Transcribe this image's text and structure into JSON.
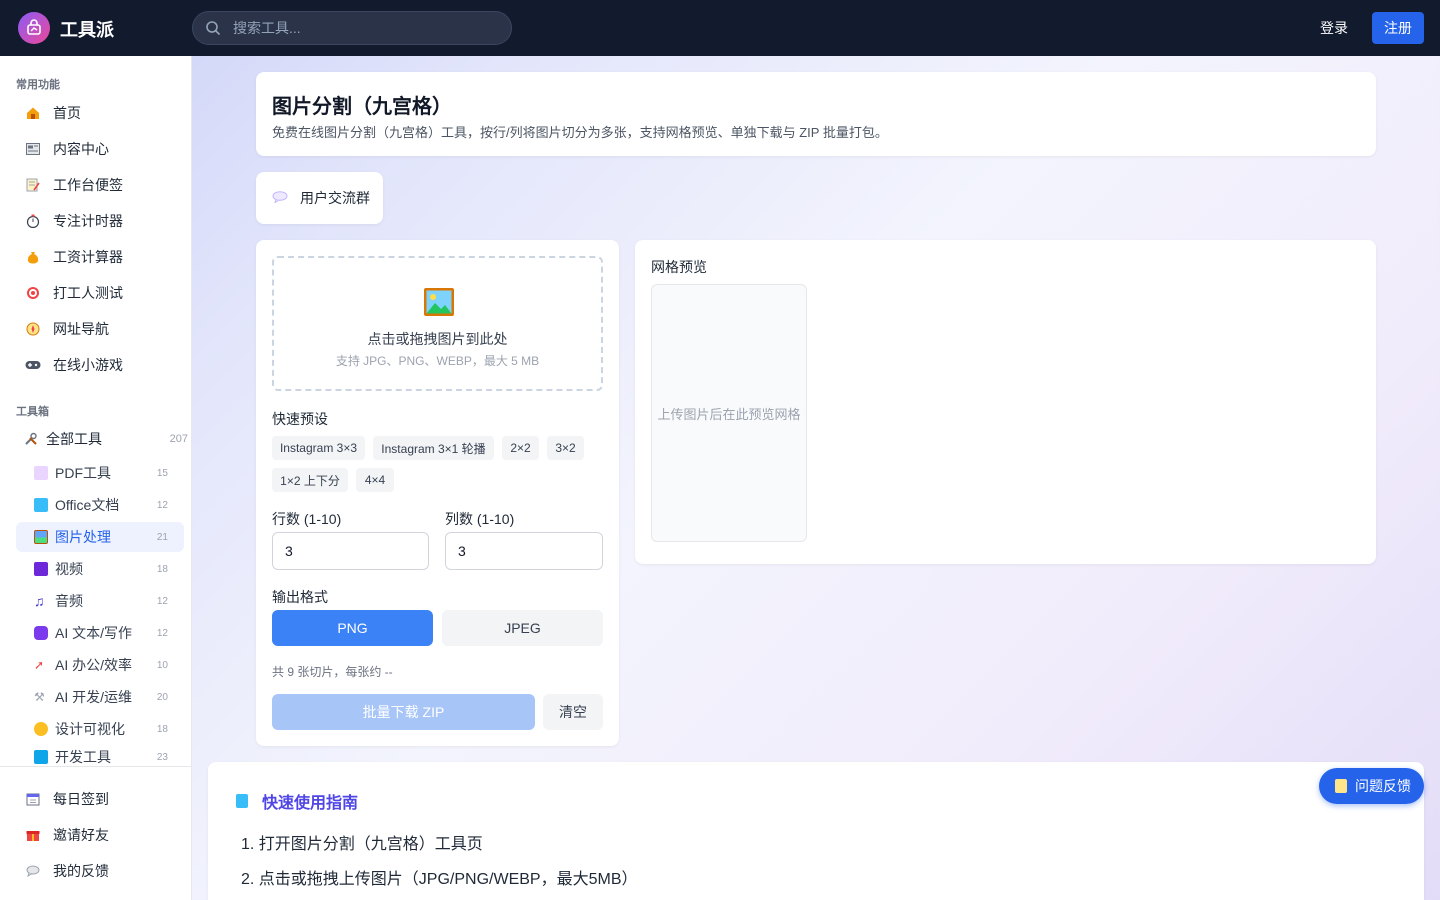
{
  "header": {
    "brand": "工具派",
    "search_placeholder": "搜索工具...",
    "login": "登录",
    "register": "注册"
  },
  "sidebar": {
    "common_title": "常用功能",
    "common_items": [
      {
        "label": "首页",
        "icon": "home-icon"
      },
      {
        "label": "内容中心",
        "icon": "newspaper-icon"
      },
      {
        "label": "工作台便签",
        "icon": "memo-icon"
      },
      {
        "label": "专注计时器",
        "icon": "stopwatch-icon"
      },
      {
        "label": "工资计算器",
        "icon": "money-bag-icon"
      },
      {
        "label": "打工人测试",
        "icon": "target-icon"
      },
      {
        "label": "网址导航",
        "icon": "compass-icon"
      },
      {
        "label": "在线小游戏",
        "icon": "gamepad-icon"
      }
    ],
    "toolbox_title": "工具箱",
    "all_tools": {
      "label": "全部工具",
      "count": "207"
    },
    "sub_items": [
      {
        "label": "PDF工具",
        "count": "15"
      },
      {
        "label": "Office文档",
        "count": "12"
      },
      {
        "label": "图片处理",
        "count": "21"
      },
      {
        "label": "视频",
        "count": "18"
      },
      {
        "label": "音频",
        "count": "12"
      },
      {
        "label": "AI 文本/写作",
        "count": "12"
      },
      {
        "label": "AI 办公/效率",
        "count": "10"
      },
      {
        "label": "AI 开发/运维",
        "count": "20"
      },
      {
        "label": "设计可视化",
        "count": "18"
      },
      {
        "label": "开发工具",
        "count": "23"
      }
    ],
    "bottom_items": [
      {
        "label": "每日签到"
      },
      {
        "label": "邀请好友"
      },
      {
        "label": "我的反馈"
      }
    ]
  },
  "page": {
    "title": "图片分割（九宫格）",
    "description": "免费在线图片分割（九宫格）工具，按行/列将图片切分为多张，支持网格预览、单独下载与 ZIP 批量打包。",
    "group_button": "用户交流群"
  },
  "upload": {
    "main_text": "点击或拖拽图片到此处",
    "hint": "支持 JPG、PNG、WEBP，最大 5 MB"
  },
  "presets": {
    "label": "快速预设",
    "chips": [
      "Instagram 3×3",
      "Instagram 3×1 轮播",
      "2×2",
      "3×2",
      "1×2 上下分",
      "4×4"
    ]
  },
  "grid": {
    "rows_label": "行数 (1-10)",
    "rows_value": "3",
    "cols_label": "列数 (1-10)",
    "cols_value": "3"
  },
  "format": {
    "label": "输出格式",
    "options": [
      "PNG",
      "JPEG"
    ],
    "selected": "PNG"
  },
  "summary": "共 9 张切片，每张约 --",
  "actions": {
    "zip": "批量下载 ZIP",
    "clear": "清空"
  },
  "preview": {
    "title": "网格预览",
    "placeholder": "上传图片后在此预览网格"
  },
  "guide": {
    "title": "快速使用指南",
    "steps": [
      "1. 打开图片分割（九宫格）工具页",
      "2. 点击或拖拽上传图片（JPG/PNG/WEBP，最大5MB）"
    ]
  },
  "feedback": "问题反馈",
  "colors": {
    "header_bg": "#121a2e",
    "accent": "#2563eb",
    "primary_button": "#3b82f6",
    "disabled_button": "#a8c5f8",
    "guide_title": "#4f46e5"
  }
}
